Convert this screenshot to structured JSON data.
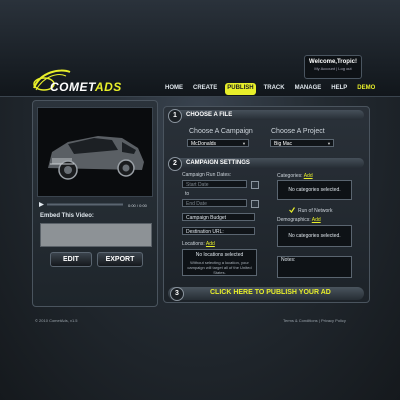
{
  "header": {
    "logo_prefix": "COMET",
    "logo_suffix": "ADS",
    "welcome_text": "Welcome,Tropic!",
    "account_links": "My Account | Log out"
  },
  "nav": {
    "items": [
      "HOME",
      "CREATE",
      "PUBLISH",
      "TRACK",
      "MANAGE",
      "HELP",
      "DEMO"
    ],
    "active": "PUBLISH"
  },
  "video": {
    "time": "0:00 / 0:00"
  },
  "embed": {
    "label": "Embed This Video:"
  },
  "actions": {
    "edit_label": "EDIT",
    "export_label": "EXPORT"
  },
  "section1": {
    "num": "1",
    "title": "CHOOSE A FILE",
    "campaign_label": "Choose A Campaign",
    "campaign_value": "McDonalds",
    "project_label": "Choose A Project",
    "project_value": "Big Mac"
  },
  "section2": {
    "num": "2",
    "title": "CAMPAIGN SETTINGS",
    "run_dates_label": "Campaign Run Dates:",
    "start_placeholder": "Start Date",
    "to_text": "to",
    "end_placeholder": "End Date",
    "budget_placeholder": "Campaign Budget",
    "url_placeholder": "Destination URL:",
    "locations_label": "Locations:",
    "locations_add": "Add",
    "locations_empty": "No locations selected",
    "locations_note": "Without selecting a location, your campaign will target all of the United States.",
    "categories_label": "Categories:",
    "categories_add": "Add",
    "categories_empty": "No categories selected.",
    "run_of_network_label": "Run of Network",
    "run_of_network_checked": true,
    "demographics_label": "Demographics:",
    "demographics_add": "Add",
    "demographics_empty": "No categories selected.",
    "notes_label": "Notes:"
  },
  "section3": {
    "num": "3",
    "title": "CLICK HERE TO PUBLISH YOUR AD"
  },
  "footer": {
    "copyright": "© 2010 CometAds, v1.5",
    "links": "Terms & Conditions | Privacy Policy"
  },
  "colors": {
    "accent": "#e8ef2a",
    "background": "#1a1f24",
    "panel": "#262d34"
  }
}
